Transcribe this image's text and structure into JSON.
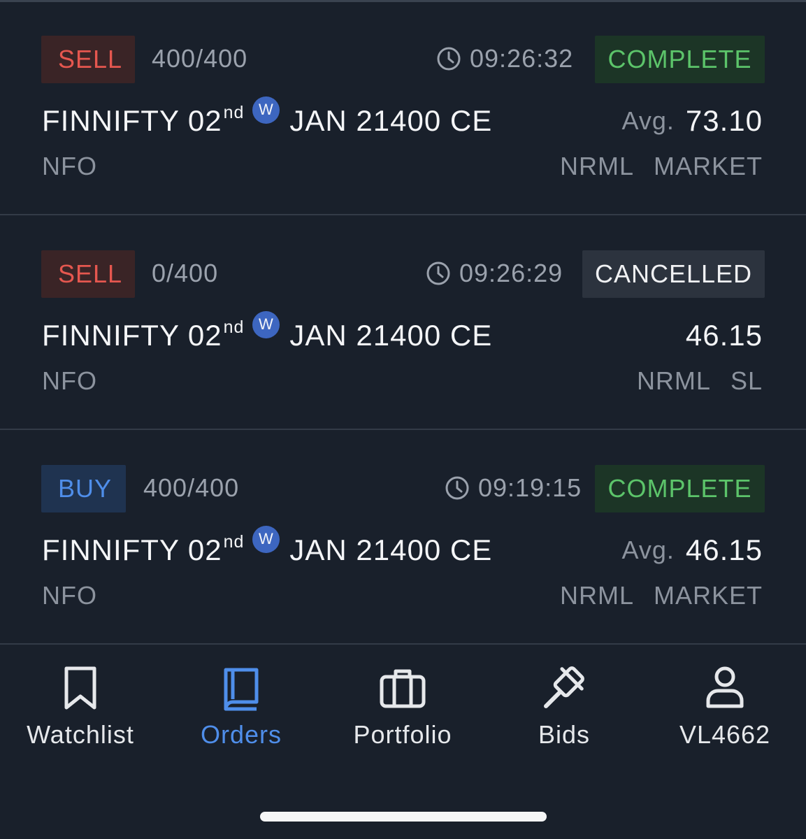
{
  "orders": [
    {
      "side": "SELL",
      "quantity": "400/400",
      "time": "09:26:32",
      "status": "COMPLETE",
      "instrument_name": "FINNIFTY 02",
      "instrument_suffix": "nd",
      "weekly_badge": "W",
      "instrument_rest": "JAN 21400 CE",
      "price_label": "Avg.",
      "price": "73.10",
      "exchange": "NFO",
      "product": "NRML",
      "order_type": "MARKET"
    },
    {
      "side": "SELL",
      "quantity": "0/400",
      "time": "09:26:29",
      "status": "CANCELLED",
      "instrument_name": "FINNIFTY 02",
      "instrument_suffix": "nd",
      "weekly_badge": "W",
      "instrument_rest": "JAN 21400 CE",
      "price_label": "",
      "price": "46.15",
      "exchange": "NFO",
      "product": "NRML",
      "order_type": "SL"
    },
    {
      "side": "BUY",
      "quantity": "400/400",
      "time": "09:19:15",
      "status": "COMPLETE",
      "instrument_name": "FINNIFTY 02",
      "instrument_suffix": "nd",
      "weekly_badge": "W",
      "instrument_rest": "JAN 21400 CE",
      "price_label": "Avg.",
      "price": "46.15",
      "exchange": "NFO",
      "product": "NRML",
      "order_type": "MARKET"
    }
  ],
  "nav": {
    "items": [
      {
        "label": "Watchlist",
        "icon": "bookmark-icon"
      },
      {
        "label": "Orders",
        "icon": "book-icon",
        "active": true
      },
      {
        "label": "Portfolio",
        "icon": "briefcase-icon"
      },
      {
        "label": "Bids",
        "icon": "gavel-icon"
      },
      {
        "label": "VL4662",
        "icon": "user-icon"
      }
    ]
  },
  "colors": {
    "background": "#19202b",
    "sell": "#e5574f",
    "buy": "#4f8eea",
    "complete": "#5cc46a",
    "active_nav": "#4f8eea"
  }
}
